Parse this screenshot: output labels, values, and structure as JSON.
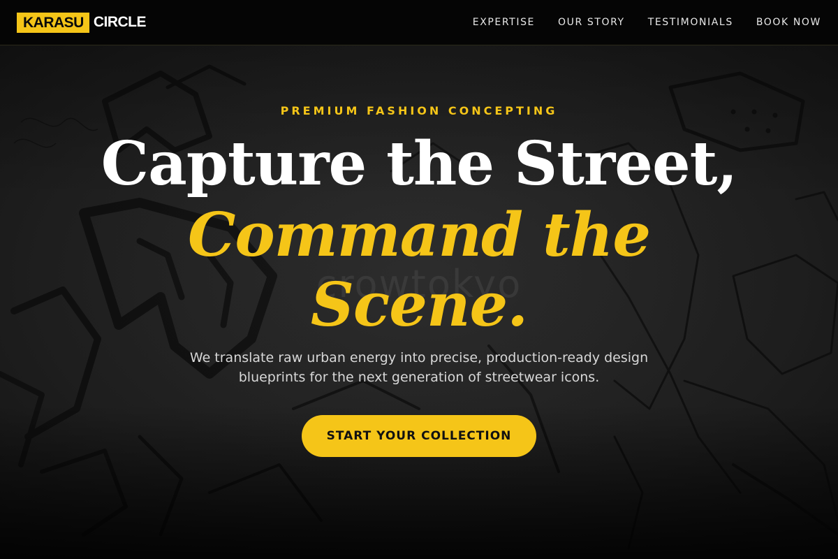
{
  "brand": {
    "highlight": "KARASU",
    "text": "CIRCLE",
    "accent_color": "#f5c518"
  },
  "nav": {
    "items": [
      {
        "label": "EXPERTISE"
      },
      {
        "label": "OUR STORY"
      },
      {
        "label": "TESTIMONIALS"
      },
      {
        "label": "BOOK NOW"
      }
    ]
  },
  "hero": {
    "eyebrow": "PREMIUM FASHION CONCEPTING",
    "headline_line1": "Capture the Street,",
    "headline_line2": "Command the",
    "headline_line3": "Scene.",
    "subtitle": "We translate raw urban energy into precise, production-ready design blueprints for the next generation of streetwear icons.",
    "cta_label": "START YOUR COLLECTION",
    "watermark": "crowtokyo",
    "background_image": "dark-sketch-background"
  }
}
